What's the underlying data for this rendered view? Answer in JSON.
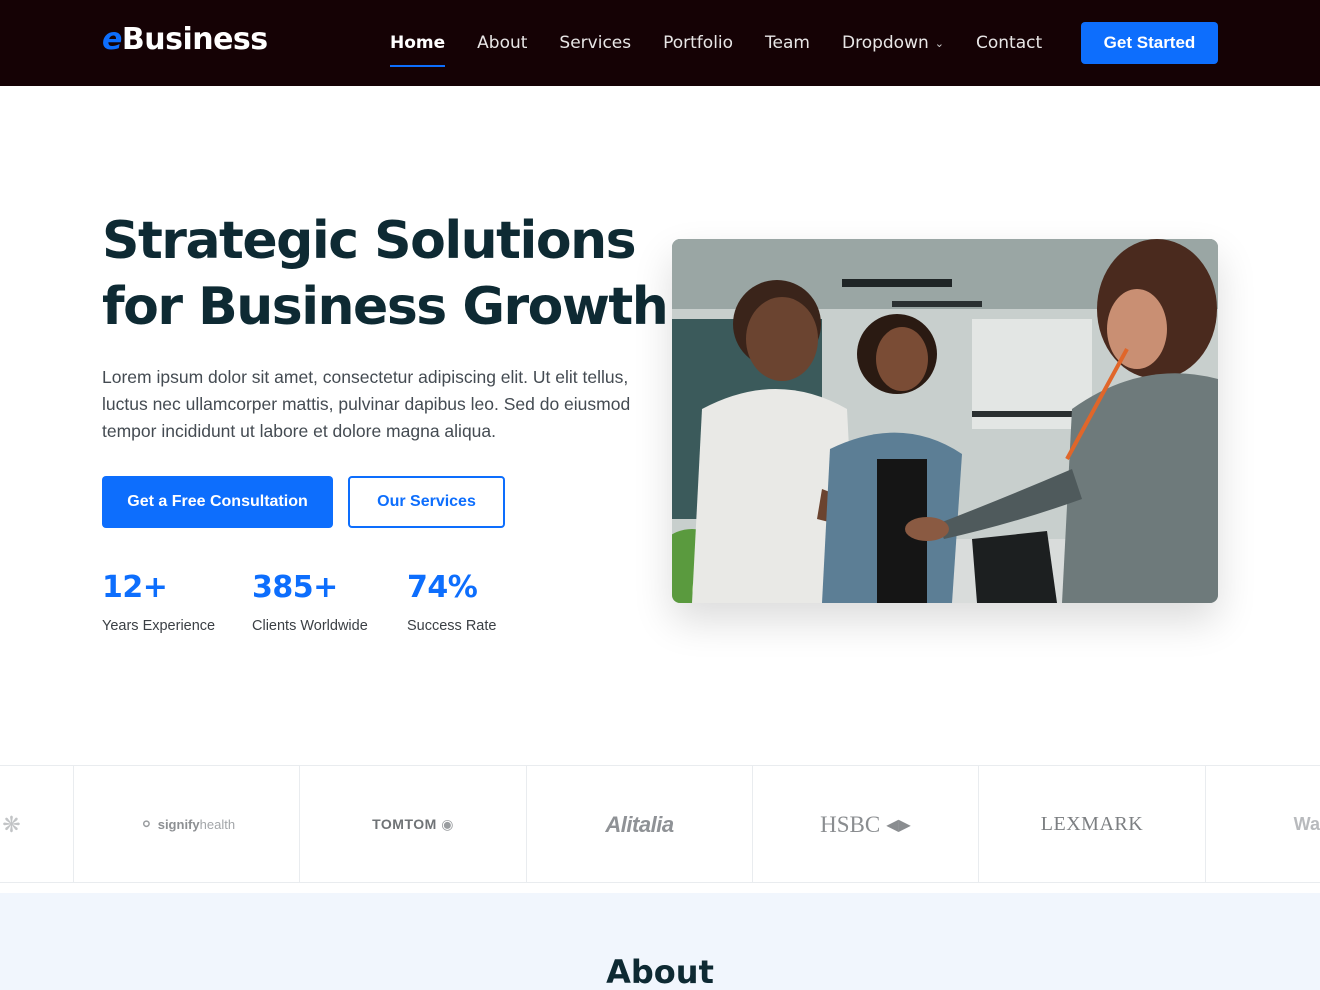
{
  "header": {
    "logo_accent": "e",
    "logo_rest": "Business",
    "nav": [
      {
        "label": "Home",
        "active": true
      },
      {
        "label": "About"
      },
      {
        "label": "Services"
      },
      {
        "label": "Portfolio"
      },
      {
        "label": "Team"
      },
      {
        "label": "Dropdown",
        "has_dropdown": true,
        "icon": "chevron-down-icon"
      },
      {
        "label": "Contact"
      }
    ],
    "cta_label": "Get Started"
  },
  "hero": {
    "title_line1": "Strategic Solutions",
    "title_line2": "for Business Growth",
    "description": "Lorem ipsum dolor sit amet, consectetur adipiscing elit. Ut elit tellus, luctus nec ullamcorper mattis, pulvinar dapibus leo. Sed do eiusmod tempor incididunt ut labore et dolore magna aliqua.",
    "primary_button": "Get a Free Consultation",
    "secondary_button": "Our Services",
    "stats": [
      {
        "value": "12+",
        "label": "Years Experience"
      },
      {
        "value": "385+",
        "label": "Clients Worldwide"
      },
      {
        "value": "74%",
        "label": "Success Rate"
      }
    ]
  },
  "clients": {
    "logos": [
      "signifyhealth",
      "TOMTOM",
      "Alitalia",
      "HSBC",
      "LEXMARK",
      "Wa"
    ],
    "signify_bold": "signify",
    "signify_thin": "health"
  },
  "about": {
    "title": "About"
  },
  "colors": {
    "accent": "#0d6efd",
    "header_bg": "#150205",
    "heading": "#0e2a33",
    "section_bg": "#f1f6fd"
  }
}
